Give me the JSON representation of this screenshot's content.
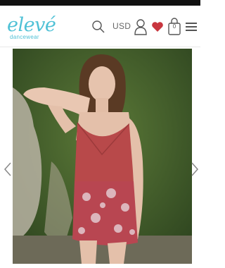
{
  "header": {
    "logo_text": "elevé",
    "logo_sub": "dancewear",
    "currency": "USD",
    "cart_count": "0"
  },
  "colors": {
    "brand": "#4fc1d6",
    "heart": "#c8363f",
    "leotard": "#b8494a"
  },
  "icons": [
    "search-icon",
    "user-icon",
    "heart-icon",
    "shopping-bag-icon",
    "menu-icon",
    "chevron-left-icon",
    "chevron-right-icon"
  ]
}
